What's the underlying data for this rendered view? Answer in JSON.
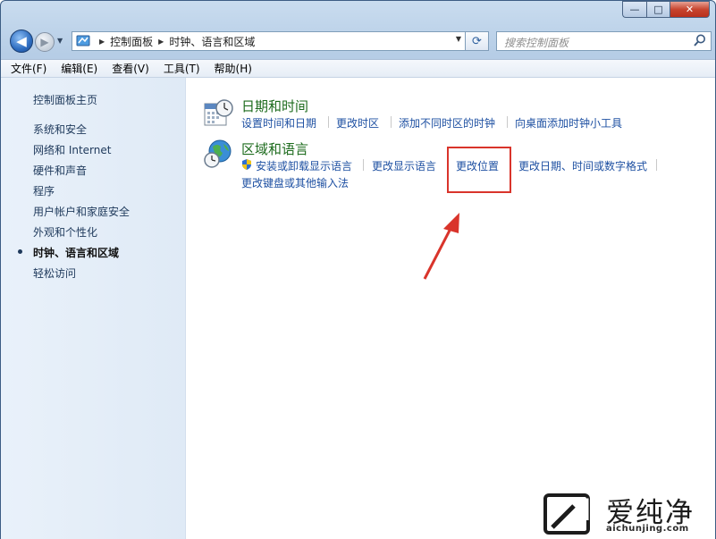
{
  "window": {
    "caption_buttons": {
      "minimize": "—",
      "maximize": "□",
      "close": "✕"
    }
  },
  "nav": {
    "breadcrumb": [
      "控制面板",
      "时钟、语言和区域"
    ],
    "search_placeholder": "搜索控制面板"
  },
  "menu": [
    "文件(F)",
    "编辑(E)",
    "查看(V)",
    "工具(T)",
    "帮助(H)"
  ],
  "sidebar": {
    "home": "控制面板主页",
    "items": [
      "系统和安全",
      "网络和 Internet",
      "硬件和声音",
      "程序",
      "用户帐户和家庭安全",
      "外观和个性化",
      "时钟、语言和区域",
      "轻松访问"
    ],
    "current_index": 6
  },
  "categories": [
    {
      "title": "日期和时间",
      "icon": "calendar-clock-icon",
      "links": [
        "设置时间和日期",
        "更改时区",
        "添加不同时区的时钟",
        "向桌面添加时钟小工具"
      ]
    },
    {
      "title": "区域和语言",
      "icon": "globe-clock-icon",
      "links": [
        "安装或卸载显示语言",
        "更改显示语言",
        "更改位置",
        "更改日期、时间或数字格式",
        "更改键盘或其他输入法"
      ]
    }
  ],
  "annotation": {
    "highlight_color": "#d9342b",
    "target": "更改位置"
  },
  "watermark": {
    "name": "爱纯净",
    "url": "aichunjing.com"
  }
}
